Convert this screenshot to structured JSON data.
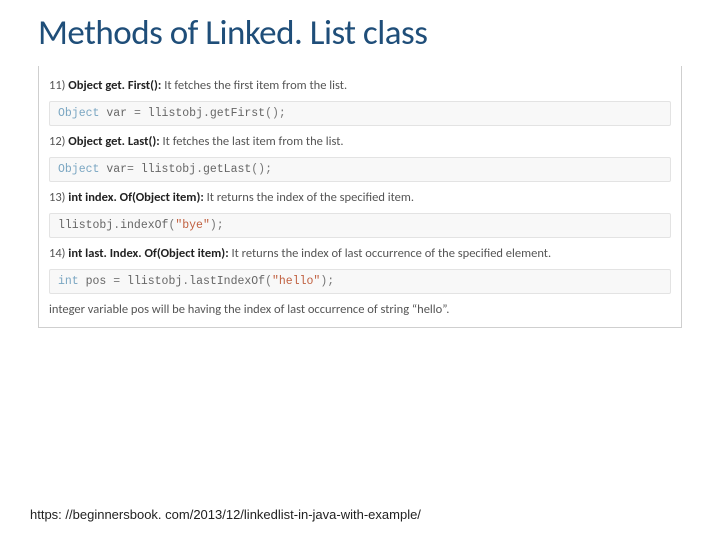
{
  "title": "Methods of Linked. List class",
  "methods": [
    {
      "num": "11)",
      "sig": "Object get. First():",
      "desc": "It fetches the first item from the list.",
      "code_html": "<span class='type'>Object</span> var <span class='punct'>=</span> llistobj<span class='punct'>.</span>getFirst<span class='punct'>();</span>"
    },
    {
      "num": "12)",
      "sig": "Object get. Last():",
      "desc": "It fetches the last item from the list.",
      "code_html": "<span class='type'>Object</span> var<span class='punct'>=</span> llistobj<span class='punct'>.</span>getLast<span class='punct'>();</span>"
    },
    {
      "num": "13)",
      "sig": "int index. Of(Object item):",
      "desc": "It returns the index of the specified item.",
      "code_html": "llistobj<span class='punct'>.</span>indexOf<span class='punct'>(</span><span class='str'>\"bye\"</span><span class='punct'>);</span>"
    },
    {
      "num": "14)",
      "sig": "int last. Index. Of(Object item):",
      "desc": "It returns the index of last occurrence of the specified element.",
      "code_html": "<span class='type'>int</span> pos <span class='punct'>=</span> llistobj<span class='punct'>.</span>lastIndexOf<span class='punct'>(</span><span class='str'>\"hello\"</span><span class='punct'>);</span>"
    }
  ],
  "note": "integer variable pos will be having the index of last occurrence of string “hello”.",
  "footer_url": "https: //beginnersbook. com/2013/12/linkedlist-in-java-with-example/"
}
